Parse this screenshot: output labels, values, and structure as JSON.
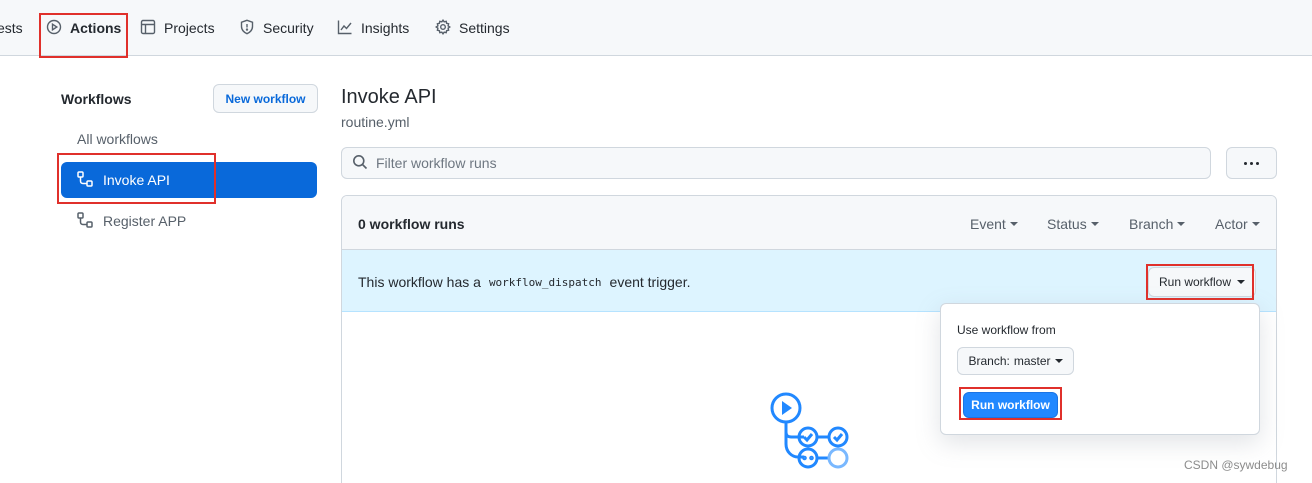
{
  "topnav": {
    "tabs": [
      {
        "label": "ests",
        "icon": "pull-request-icon"
      },
      {
        "label": "Actions",
        "icon": "play-icon"
      },
      {
        "label": "Projects",
        "icon": "table-icon"
      },
      {
        "label": "Security",
        "icon": "shield-icon"
      },
      {
        "label": "Insights",
        "icon": "graph-icon"
      },
      {
        "label": "Settings",
        "icon": "gear-icon"
      }
    ]
  },
  "sidebar": {
    "title": "Workflows",
    "new_workflow_label": "New workflow",
    "all_label": "All workflows",
    "items": [
      {
        "label": "Invoke API",
        "icon": "workflow-icon",
        "active": true
      },
      {
        "label": "Register APP",
        "icon": "workflow-icon",
        "active": false
      }
    ]
  },
  "main": {
    "title": "Invoke API",
    "subtitle": "routine.yml",
    "filter_placeholder": "Filter workflow runs",
    "runs_count": "0 workflow runs",
    "filters": [
      "Event",
      "Status",
      "Branch",
      "Actor"
    ],
    "dispatch": {
      "prefix": "This workflow has a",
      "code": "workflow_dispatch",
      "suffix": "event trigger."
    },
    "run_workflow_label": "Run workflow"
  },
  "popover": {
    "label": "Use workflow from",
    "branch_prefix": "Branch:",
    "branch_value": "master",
    "submit_label": "Run workflow"
  },
  "colors": {
    "accent": "#0969da",
    "highlight_box": "#e0302b",
    "dispatch_bg": "#ddf4ff",
    "primary_button": "#2188ff"
  },
  "watermark": "CSDN @sywdebug"
}
